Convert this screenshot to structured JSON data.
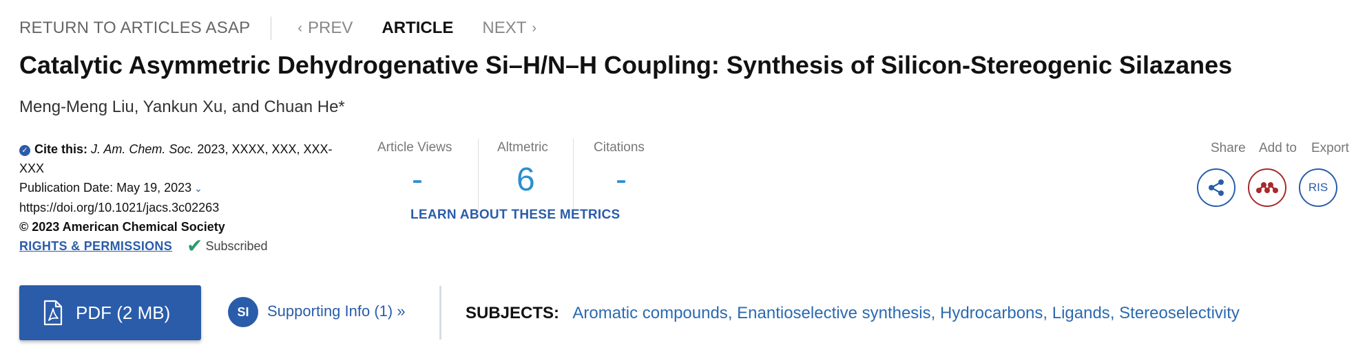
{
  "nav": {
    "return_label": "RETURN TO ARTICLES ASAP",
    "prev_label": "PREV",
    "article_label": "ARTICLE",
    "next_label": "NEXT"
  },
  "article": {
    "title": "Catalytic Asymmetric Dehydrogenative Si–H/N–H Coupling: Synthesis of Silicon-Stereogenic Silazanes",
    "authors": "Meng-Meng Liu, Yankun Xu, and Chuan He*"
  },
  "cite": {
    "label": "Cite this:",
    "journal": "J. Am. Chem. Soc.",
    "ref": "2023, XXXX, XXX, XXX-XXX",
    "pub_date": "Publication Date: May 19, 2023",
    "doi": "https://doi.org/10.1021/jacs.3c02263",
    "copyright": "© 2023 American Chemical Society",
    "rights_label": "RIGHTS & PERMISSIONS",
    "subscribed_label": "Subscribed"
  },
  "metrics": {
    "views_label": "Article Views",
    "views_value": "-",
    "altmetric_label": "Altmetric",
    "altmetric_value": "6",
    "citations_label": "Citations",
    "citations_value": "-",
    "learn_label": "LEARN ABOUT THESE METRICS"
  },
  "tools": {
    "share_label": "Share",
    "add_label": "Add to",
    "export_label": "Export",
    "ris_label": "RIS"
  },
  "bottom": {
    "pdf_label": "PDF (2 MB)",
    "si_badge": "SI",
    "si_label": "Supporting Info (1) »",
    "subjects_label": "SUBJECTS:",
    "subjects": [
      "Aromatic compounds",
      "Enantioselective synthesis",
      "Hydrocarbons",
      "Ligands",
      "Stereoselectivity"
    ]
  },
  "colors": {
    "brand_blue": "#2a5caa",
    "metric_blue": "#2b8fd1",
    "mendeley_red": "#a82a2a",
    "subscribed_green": "#2e9b6b"
  },
  "icons": {
    "prev": "chevron-left-icon",
    "next": "chevron-right-icon",
    "cite": "check-circle-icon",
    "subscribed": "checkmark-icon",
    "share": "share-icon",
    "add": "mendeley-icon",
    "pdf": "pdf-file-icon"
  }
}
